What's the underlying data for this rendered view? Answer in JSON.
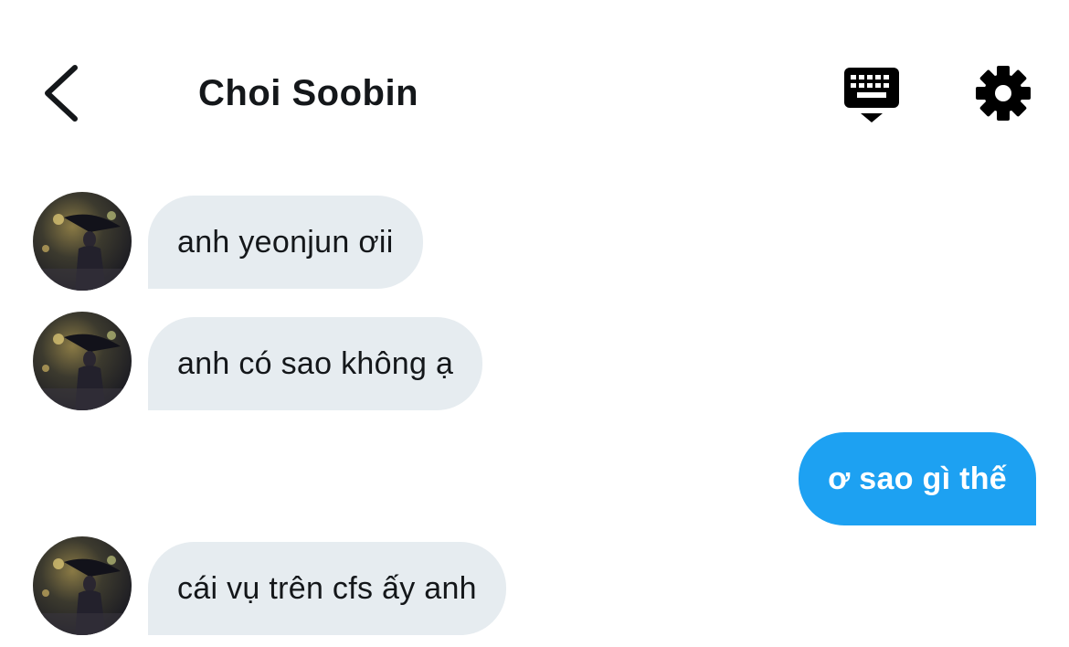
{
  "header": {
    "title": "Choi Soobin",
    "back_icon": "chevron-left-icon",
    "keyboard_icon": "keyboard-icon",
    "settings_icon": "gear-icon"
  },
  "messages": [
    {
      "direction": "incoming",
      "text": "anh yeonjun ơii"
    },
    {
      "direction": "incoming",
      "text": "anh có sao không ạ"
    },
    {
      "direction": "outgoing",
      "text": "ơ sao gì thế"
    },
    {
      "direction": "incoming",
      "text": "cái vụ trên cfs ấy anh"
    }
  ],
  "colors": {
    "incoming_bubble": "#e6ecf0",
    "outgoing_bubble": "#1da1f2",
    "text_primary": "#14171a",
    "icon": "#000000"
  }
}
